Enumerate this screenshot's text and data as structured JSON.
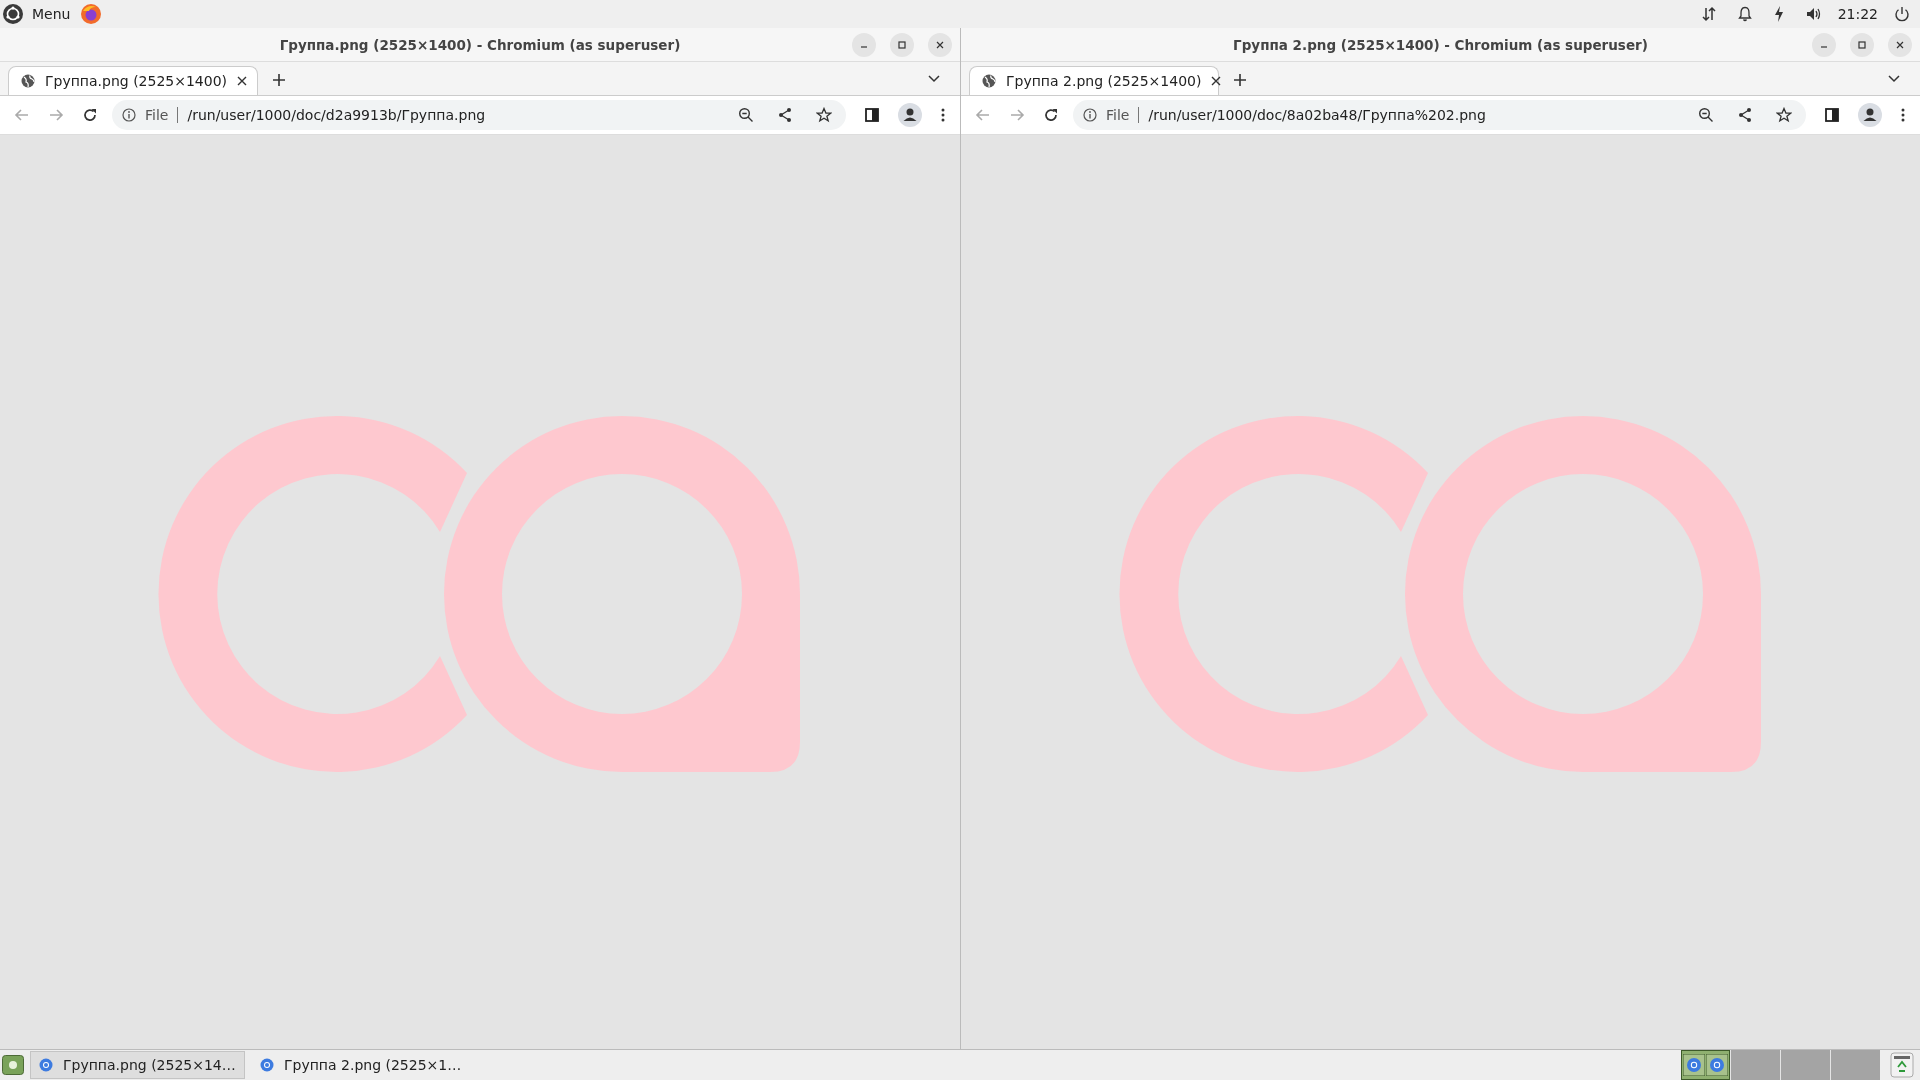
{
  "top_panel": {
    "menu_label": "Menu",
    "clock": "21:22"
  },
  "windows": [
    {
      "title": "Группа.png (2525×1400) - Chromium (as superuser)",
      "tab": {
        "label": "Группа.png (2525×1400)",
        "selected": true
      },
      "url_scheme": "File",
      "url": "/run/user/1000/doc/d2a9913b/Группа.png"
    },
    {
      "title": "Группа 2.png (2525×1400) - Chromium (as superuser)",
      "tab": {
        "label": "Группа 2.png (2525×1400)",
        "selected": true
      },
      "url_scheme": "File",
      "url": "/run/user/1000/doc/8a02ba48/Группа%202.png"
    }
  ],
  "taskbar": {
    "buttons": [
      {
        "label": "Группа.png (2525×14…",
        "selected": true
      },
      {
        "label": "Группа 2.png (2525×1…",
        "selected": false
      }
    ],
    "workspaces": [
      {
        "selected": true
      },
      {
        "selected": false
      },
      {
        "selected": false
      },
      {
        "selected": false
      }
    ]
  }
}
